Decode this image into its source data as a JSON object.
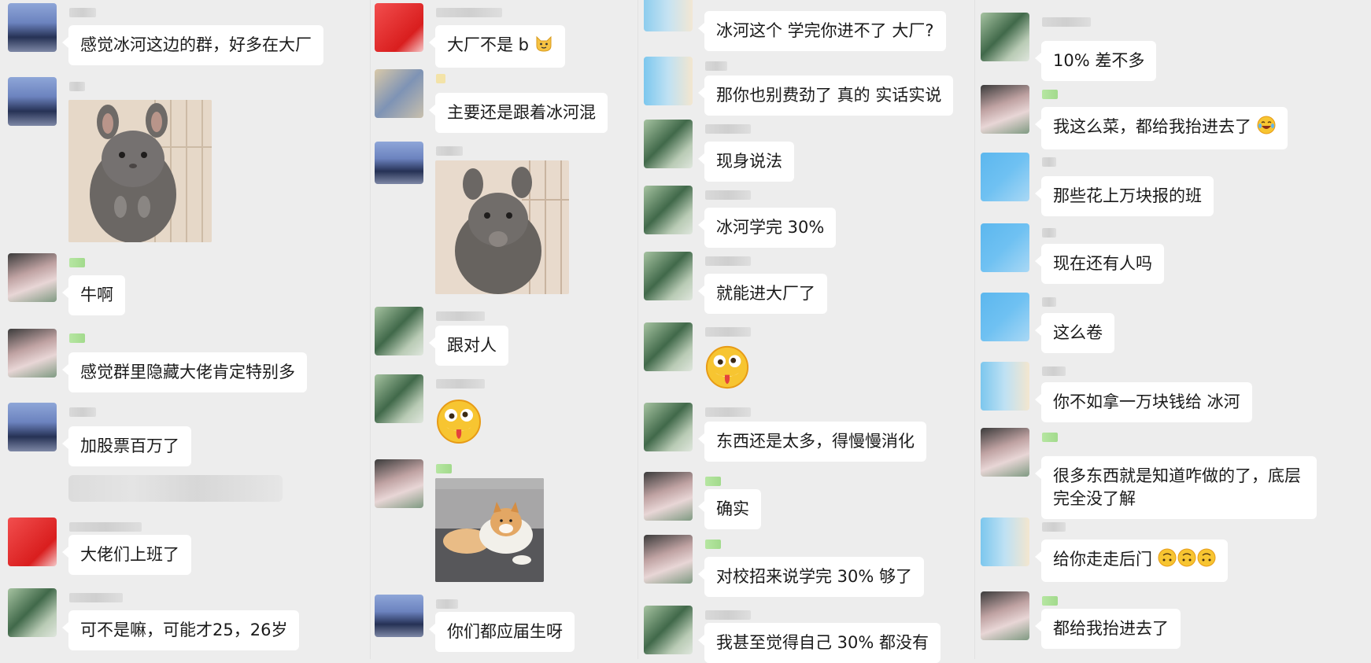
{
  "columns": [
    {
      "messages": [
        {
          "text": "感觉冰河这边的群，好多在大厂"
        },
        {
          "image": "chinchilla-sticker"
        },
        {
          "text": "牛啊"
        },
        {
          "text": "感觉群里隐藏大佬肯定特别多"
        },
        {
          "text": "加股票百万了"
        },
        {
          "text": "大佬们上班了"
        },
        {
          "text": "可不是嘛，可能才25，26岁"
        }
      ]
    },
    {
      "messages": [
        {
          "text": "大厂不是 b",
          "emoji": "cat-face-emoji"
        },
        {
          "text": "主要还是跟着冰河混"
        },
        {
          "image": "chinchilla-eating-sticker"
        },
        {
          "text": "跟对人"
        },
        {
          "emoji": "drooling-face-emoji"
        },
        {
          "image": "shiba-dog-sticker"
        },
        {
          "text": "你们都应届生呀"
        }
      ]
    },
    {
      "messages": [
        {
          "text": "冰河这个 学完你进不了 大厂?"
        },
        {
          "text": "那你也别费劲了 真的 实话实说"
        },
        {
          "text": "现身说法"
        },
        {
          "text": "冰河学完 30%"
        },
        {
          "text": "就能进大厂了"
        },
        {
          "emoji": "drooling-face-emoji"
        },
        {
          "text": "东西还是太多，得慢慢消化"
        },
        {
          "text": "确实"
        },
        {
          "text": "对校招来说学完 30% 够了"
        },
        {
          "text": "我甚至觉得自己 30% 都没有"
        }
      ]
    },
    {
      "messages": [
        {
          "text": "10% 差不多"
        },
        {
          "text": "我这么菜，都给我抬进去了",
          "emoji": "laughing-tears-emoji"
        },
        {
          "text": "那些花上万块报的班"
        },
        {
          "text": "现在还有人吗"
        },
        {
          "text": "这么卷"
        },
        {
          "text": "你不如拿一万块钱给 冰河"
        },
        {
          "text": "很多东西就是知道咋做的了，底层完全没了解"
        },
        {
          "text": "给你走走后门",
          "emoji": "upside-down-face-emoji"
        },
        {
          "text": "都给我抬进去了"
        }
      ]
    }
  ],
  "colors": {
    "background": "#ededed",
    "bubble": "#ffffff",
    "text": "#1a1a1a"
  }
}
